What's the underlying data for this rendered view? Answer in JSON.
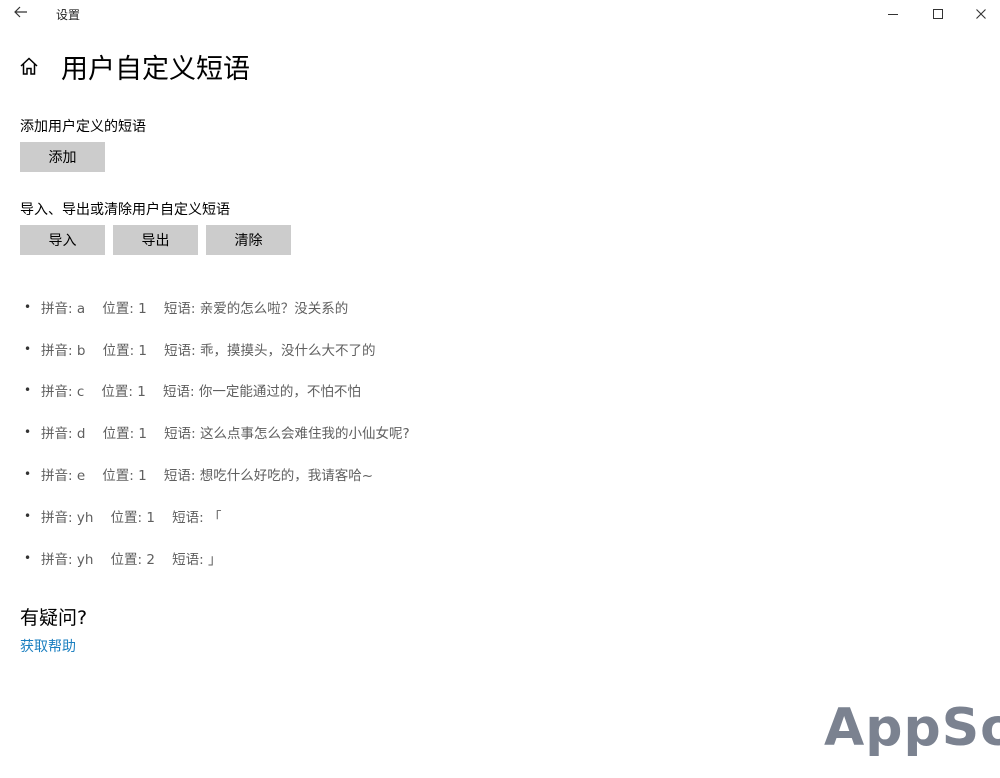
{
  "window": {
    "title": "设置"
  },
  "page": {
    "title": "用户自定义短语"
  },
  "add_section": {
    "label": "添加用户定义的短语",
    "add_button": "添加"
  },
  "io_section": {
    "label": "导入、导出或清除用户自定义短语",
    "import_button": "导入",
    "export_button": "导出",
    "clear_button": "清除"
  },
  "phrases": [
    {
      "bullet": "•",
      "text": "拼音: a    位置: 1    短语: 亲爱的怎么啦？没关系的"
    },
    {
      "bullet": "•",
      "text": "拼音: b    位置: 1    短语: 乖，摸摸头，没什么大不了的"
    },
    {
      "bullet": "•",
      "text": "拼音: c    位置: 1    短语: 你一定能通过的，不怕不怕"
    },
    {
      "bullet": "•",
      "text": "拼音: d    位置: 1    短语: 这么点事怎么会难住我的小仙女呢?"
    },
    {
      "bullet": "•",
      "text": "拼音: e    位置: 1    短语: 想吃什么好吃的，我请客哈~"
    },
    {
      "bullet": "•",
      "text": "拼音: yh    位置: 1    短语: 「"
    },
    {
      "bullet": "•",
      "text": "拼音: yh    位置: 2    短语: 」"
    }
  ],
  "help": {
    "title": "有疑问?",
    "link": "获取帮助"
  },
  "watermark": "AppSo",
  "colors": {
    "button_bg": "#cccccc",
    "link": "#1a7fc0",
    "list_text": "#5f5f5f",
    "watermark": "#7b8290"
  },
  "icons": {
    "back": "back-arrow-icon",
    "home": "home-icon",
    "minimize": "minimize-icon",
    "maximize": "maximize-icon",
    "close": "close-icon"
  }
}
